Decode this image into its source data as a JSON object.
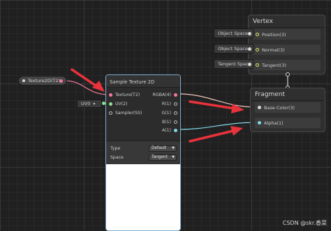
{
  "vertex_context": {
    "title": "Vertex",
    "blocks": [
      {
        "input_label": "Object Space",
        "block_label": "Position(3)"
      },
      {
        "input_label": "Object Space",
        "block_label": "Normal(3)"
      },
      {
        "input_label": "Tangent Space",
        "block_label": "Tangent(3)"
      }
    ]
  },
  "fragment_context": {
    "title": "Fragment",
    "blocks": [
      {
        "block_label": "Base Color(3)"
      },
      {
        "block_label": "Alpha(1)"
      }
    ]
  },
  "texture_property": {
    "label": "Texture2D(T2)"
  },
  "uv_input": {
    "label": "UV0",
    "chevron": "▾"
  },
  "sample_node": {
    "title": "Sample Texture 2D",
    "inputs": [
      "Texture(T2)",
      "UV(2)",
      "Sampler(SS)"
    ],
    "outputs": [
      "RGBA(4)",
      "R(1)",
      "G(1)",
      "B(1)",
      "A(1)"
    ],
    "settings": [
      {
        "label": "Type",
        "value": "Default"
      },
      {
        "label": "Space",
        "value": "Tangent"
      }
    ]
  },
  "watermark": "CSDN @skr.香菜",
  "colors": {
    "background": "#202020",
    "node_selected_border": "#7aaed0",
    "wire_color": "#f0c8c0",
    "wire_alpha": "#7fd8e6",
    "arrow_red": "#e8323c"
  }
}
